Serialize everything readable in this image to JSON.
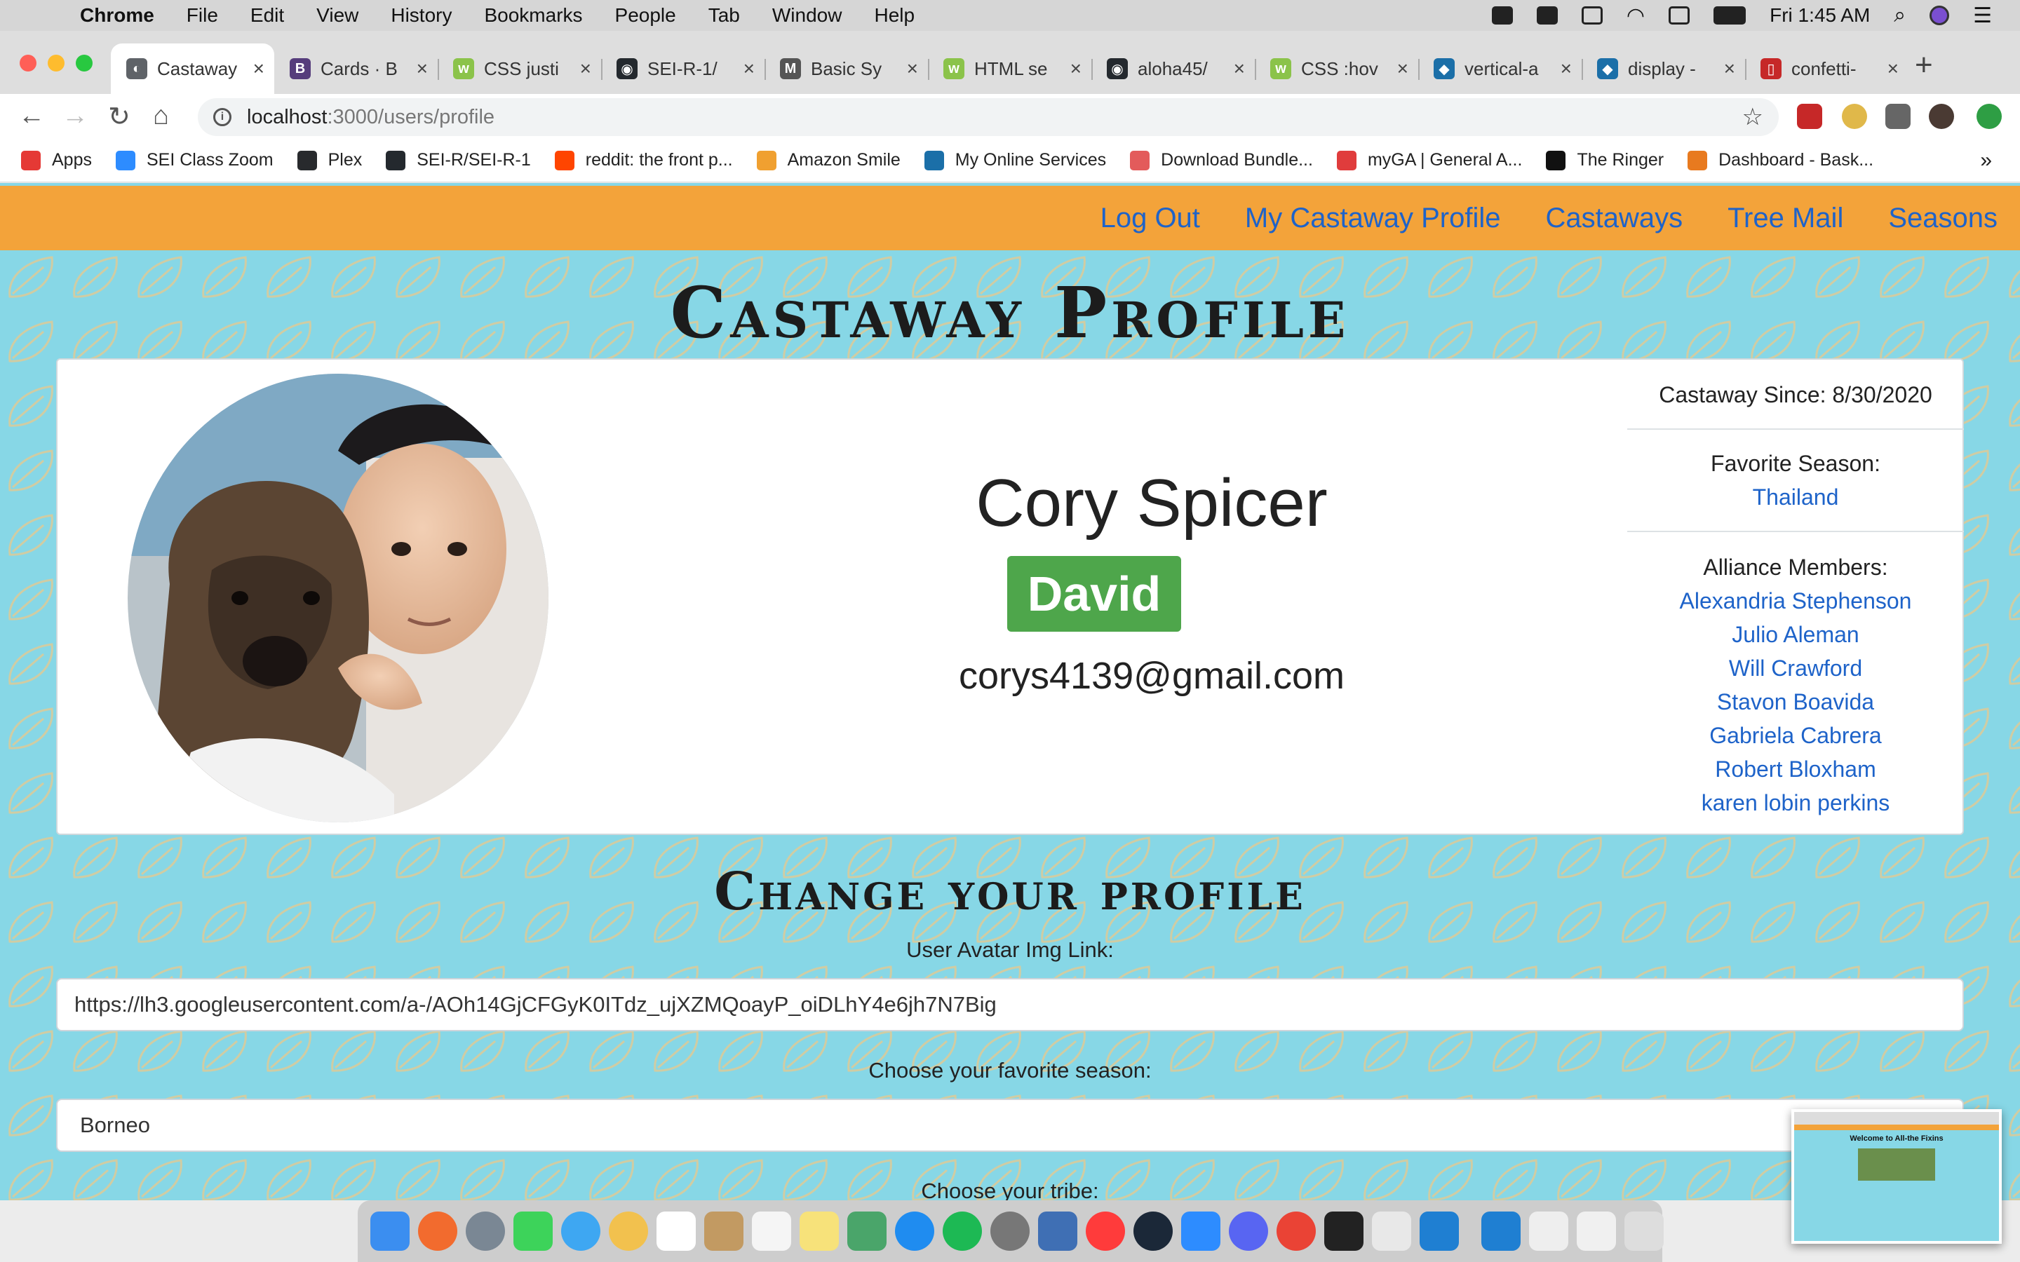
{
  "menubar": {
    "app": "Chrome",
    "items": [
      "File",
      "Edit",
      "View",
      "History",
      "Bookmarks",
      "People",
      "Tab",
      "Window",
      "Help"
    ],
    "clock": "Fri 1:45 AM"
  },
  "tabs": [
    {
      "label": "Castaway",
      "color": "#5f6368",
      "glyph": "◐"
    },
    {
      "label": "Cards · B",
      "color": "#563d7c",
      "glyph": "B"
    },
    {
      "label": "CSS justi",
      "color": "#8bc34a",
      "glyph": "w"
    },
    {
      "label": "SEI-R-1/",
      "color": "#24292e",
      "glyph": "◉"
    },
    {
      "label": "Basic Sy",
      "color": "#555555",
      "glyph": "M"
    },
    {
      "label": "HTML se",
      "color": "#8bc34a",
      "glyph": "w"
    },
    {
      "label": "aloha45/",
      "color": "#24292e",
      "glyph": "◉"
    },
    {
      "label": "CSS :hov",
      "color": "#8bc34a",
      "glyph": "w"
    },
    {
      "label": "vertical-a",
      "color": "#1b6fa8",
      "glyph": "◆"
    },
    {
      "label": "display -",
      "color": "#1b6fa8",
      "glyph": "◆"
    },
    {
      "label": "confetti-",
      "color": "#c62828",
      "glyph": "▯"
    }
  ],
  "address": {
    "host": "localhost",
    "path": ":3000/users/profile"
  },
  "bookmarks": [
    {
      "label": "Apps",
      "color": "#e53935"
    },
    {
      "label": "SEI Class Zoom",
      "color": "#2d8cff"
    },
    {
      "label": "Plex",
      "color": "#282a2d"
    },
    {
      "label": "SEI-R/SEI-R-1",
      "color": "#24292e"
    },
    {
      "label": "reddit: the front p...",
      "color": "#ff4500"
    },
    {
      "label": "Amazon Smile",
      "color": "#f0a030"
    },
    {
      "label": "My Online Services",
      "color": "#1b6fa8"
    },
    {
      "label": "Download Bundle...",
      "color": "#e35b5b"
    },
    {
      "label": "myGA | General A...",
      "color": "#e03c3c"
    },
    {
      "label": "The Ringer",
      "color": "#111111"
    },
    {
      "label": "Dashboard - Bask...",
      "color": "#e87a1f"
    }
  ],
  "site_nav": [
    "Log Out",
    "My Castaway Profile",
    "Castaways",
    "Tree Mail",
    "Seasons"
  ],
  "page_title": "Castaway Profile",
  "profile": {
    "name": "Cory Spicer",
    "tribe": "David",
    "email": "corys4139@gmail.com",
    "since_label": "Castaway Since: 8/30/2020",
    "favorite_label": "Favorite Season:",
    "favorite_season": "Thailand",
    "alliance_label": "Alliance Members:",
    "alliance": [
      "Alexandria Stephenson",
      "Julio Aleman",
      "Will Crawford",
      "Stavon Boavida",
      "Gabriela Cabrera",
      "Robert Bloxham",
      "karen lobin perkins"
    ]
  },
  "change_form": {
    "title": "Change your profile",
    "avatar_label": "User Avatar Img Link:",
    "avatar_value": "https://lh3.googleusercontent.com/a-/AOh14GjCFGyK0ITdz_ujXZMQoayP_oiDLhY4e6jh7N7Big",
    "season_label": "Choose your favorite season:",
    "season_value": "Borneo",
    "tribe_label": "Choose your tribe:"
  },
  "thumbnail": {
    "title": "Welcome to All-the Fixins"
  },
  "colors": {
    "nav_bg": "#f3a33a",
    "page_bg": "#87d7e6",
    "link": "#1e63c9",
    "tribe_badge": "#4ea64b"
  }
}
